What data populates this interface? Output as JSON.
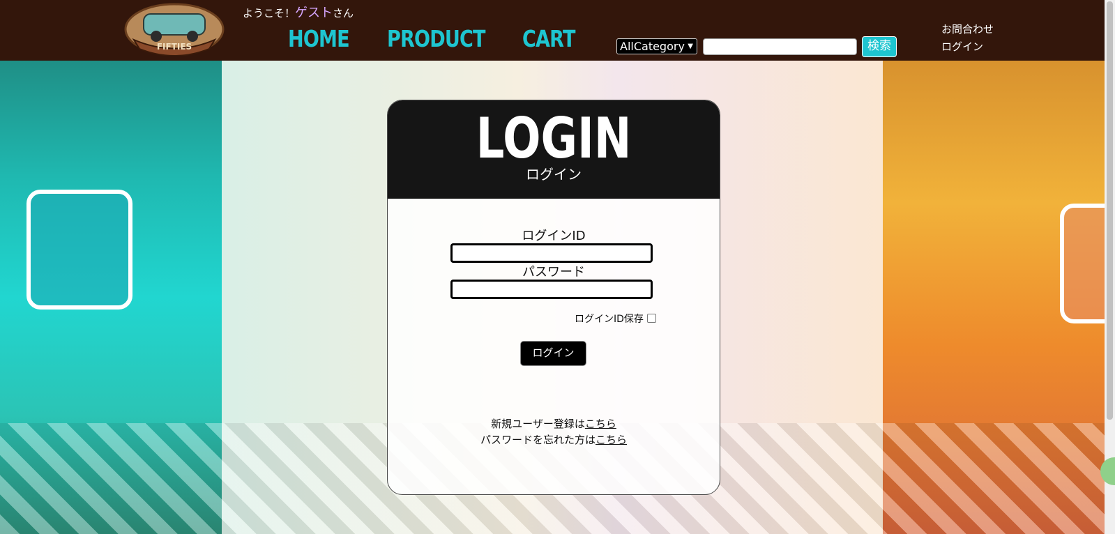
{
  "header": {
    "welcome_prefix": "ようこそ！",
    "welcome_name": "ゲスト",
    "welcome_suffix": "さん",
    "logo_text": "FIFTIES",
    "nav": {
      "home": "HOME",
      "product": "PRODUCT",
      "cart": "CART"
    },
    "category_select": "AllCategory",
    "search_value": "",
    "search_button": "検索",
    "contact_link": "お問合わせ",
    "login_link": "ログイン"
  },
  "login": {
    "title": "LOGIN",
    "subtitle": "ログイン",
    "id_label": "ログインID",
    "id_value": "",
    "password_label": "パスワード",
    "password_value": "",
    "remember_label": "ログインID保存",
    "remember_checked": false,
    "submit_label": "ログイン",
    "register_prefix": "新規ユーザー登録は",
    "register_link": "こちら",
    "forgot_prefix": "パスワードを忘れた方は",
    "forgot_link": "こちら"
  },
  "colors": {
    "header_bg": "#33160b",
    "nav_accent": "#1ec5d0",
    "guest_name": "#d6a6ff",
    "card_head": "#151515"
  }
}
